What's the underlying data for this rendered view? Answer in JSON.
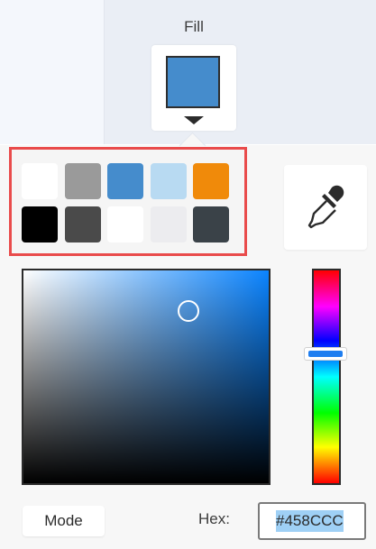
{
  "header": {
    "fill_label": "Fill",
    "fill_color": "#458CCC"
  },
  "swatches": [
    {
      "color": "#ffffff"
    },
    {
      "color": "#9a9a9a"
    },
    {
      "color": "#458CCC"
    },
    {
      "color": "#b8daf2"
    },
    {
      "color": "#f08a0a"
    },
    {
      "color": "#000000"
    },
    {
      "color": "#4a4a4a"
    },
    {
      "color": "#ffffff"
    },
    {
      "color": "#ececef"
    },
    {
      "color": "#3a4248"
    }
  ],
  "picker": {
    "hue_color": "#0b84ff",
    "hue_fraction": 0.39
  },
  "bottom": {
    "mode_label": "Mode",
    "hex_label": "Hex:",
    "hex_value": "#458CCC"
  },
  "icons": {
    "eyedropper": "eyedropper-icon",
    "caret": "caret-down-icon"
  }
}
